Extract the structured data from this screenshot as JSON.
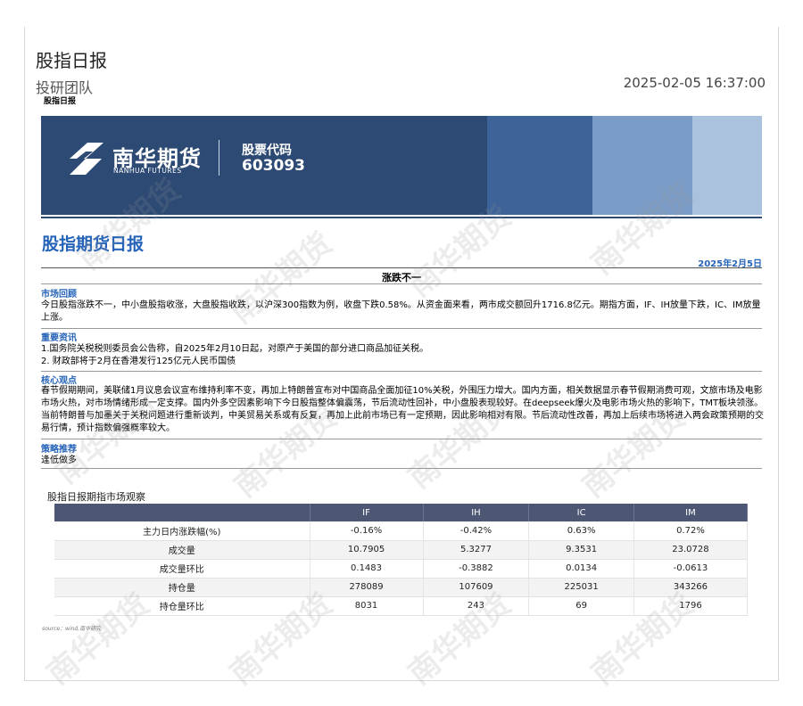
{
  "header": {
    "title": "股指日报",
    "team": "投研团队",
    "datetime": "2025-02-05 16:37:00",
    "small_label": "股指日报"
  },
  "banner": {
    "company_cn": "南华期货",
    "company_en": "NANHUA FUTURES",
    "code_label": "股票代码",
    "code_value": "603093",
    "colors": {
      "primary": "#2c4a74",
      "mid": "#3d6399",
      "light": "#7b9cc6",
      "lightest": "#aac2dd"
    }
  },
  "report": {
    "title": "股指期货日报",
    "date": "2025年2月5日",
    "headline": "涨跌不一",
    "sections": [
      {
        "title": "市场回顾",
        "text": "今日股指涨跌不一，中小盘股指收涨，大盘股指收跌，以沪深300指数为例，收盘下跌0.58%。从资金面来看，两市成交额回升1716.8亿元。期指方面，IF、IH放量下跌，IC、IM放量上涨。"
      },
      {
        "title": "重要资讯",
        "text": "1.国务院关税税则委员会公告称，自2025年2月10日起，对原产于美国的部分进口商品加征关税。\n2. 财政部将于2月在香港发行125亿元人民币国债"
      },
      {
        "title": "核心观点",
        "text": "春节假期期间，美联储1月议息会议宣布维持利率不变，再加上特朗普宣布对中国商品全面加征10%关税，外围压力增大。国内方面，相关数据显示春节假期消费可观，文旅市场及电影市场火热，对市场情绪形成一定支撑。国内外多空因素影响下今日股指整体偏震荡，节后流动性回补，中小盘股表现较好。在deepseek爆火及电影市场火热的影响下，TMT板块领涨。当前特朗普与加墨关于关税问题进行重新谈判，中美贸易关系或有反复，再加上此前市场已有一定预期，因此影响相对有限。节后流动性改善，再加上后续市场将进入两会政策预期的交易行情，预计指数偏强概率较大。"
      },
      {
        "title": "策略推荐",
        "text": "逢低做多"
      }
    ]
  },
  "table": {
    "caption": "股指日报期指市场观察",
    "headers": [
      "",
      "IF",
      "IH",
      "IC",
      "IM"
    ],
    "rows": [
      [
        "主力日内涨跌幅(%)",
        "-0.16%",
        "-0.42%",
        "0.63%",
        "0.72%"
      ],
      [
        "成交量",
        "10.7905",
        "5.3277",
        "9.3531",
        "23.0728"
      ],
      [
        "成交量环比",
        "0.1483",
        "-0.3882",
        "0.0134",
        "-0.0613"
      ],
      [
        "持仓量",
        "278089",
        "107609",
        "225031",
        "343266"
      ],
      [
        "持仓量环比",
        "8031",
        "243",
        "69",
        "1796"
      ]
    ],
    "source": "source：wind,南华研究"
  },
  "watermark": {
    "text": "南华期货"
  }
}
